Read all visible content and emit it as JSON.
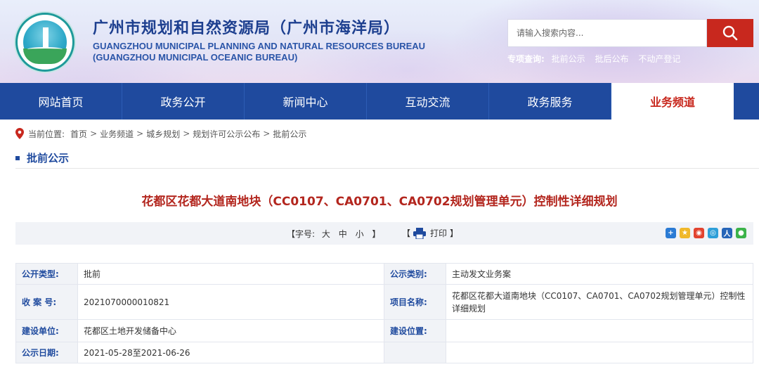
{
  "header": {
    "title_cn": "广州市规划和自然资源局（广州市海洋局）",
    "title_en_line1": "GUANGZHOU MUNICIPAL PLANNING AND NATURAL RESOURCES BUREAU",
    "title_en_line2": "(GUANGZHOU MUNICIPAL OCEANIC BUREAU)",
    "search": {
      "placeholder": "请输入搜索内容..."
    },
    "quick_label": "专项查询:",
    "quick_links": [
      "批前公示",
      "批后公布",
      "不动产登记"
    ]
  },
  "nav": {
    "items": [
      "网站首页",
      "政务公开",
      "新闻中心",
      "互动交流",
      "政务服务",
      "业务频道"
    ],
    "active": "业务频道"
  },
  "breadcrumb": {
    "label": "当前位置:",
    "items": [
      "首页",
      "业务频道",
      "城乡规划",
      "规划许可公示公布",
      "批前公示"
    ]
  },
  "section_title": "批前公示",
  "article": {
    "title": "花都区花都大道南地块（CC0107、CA0701、CA0702规划管理单元）控制性详细规划"
  },
  "toolbar": {
    "font_open": "【字号:",
    "size_large": "大",
    "size_medium": "中",
    "size_small": "小",
    "font_close": "】",
    "print_open": "【",
    "print_label": "打印",
    "print_close": "】"
  },
  "info": {
    "rows": [
      {
        "l1": "公开类型:",
        "v1": "批前",
        "l2": "公示类别:",
        "v2": "主动发文业务案"
      },
      {
        "l1": "收 案 号:",
        "v1": "2021070000010821",
        "l2": "项目名称:",
        "v2": "花都区花都大道南地块（CC0107、CA0701、CA0702规划管理单元）控制性详细规划"
      },
      {
        "l1": "建设单位:",
        "v1": "花都区土地开发储备中心",
        "l2": "建设位置:",
        "v2": ""
      },
      {
        "l1": "公示日期:",
        "v1": "2021-05-28至2021-06-26",
        "l2": "",
        "v2": ""
      }
    ]
  },
  "colors": {
    "nav_bg": "#1f4a9e",
    "accent_red": "#c8281e",
    "title_red": "#b3261e",
    "label_blue": "#1f4a9e"
  }
}
